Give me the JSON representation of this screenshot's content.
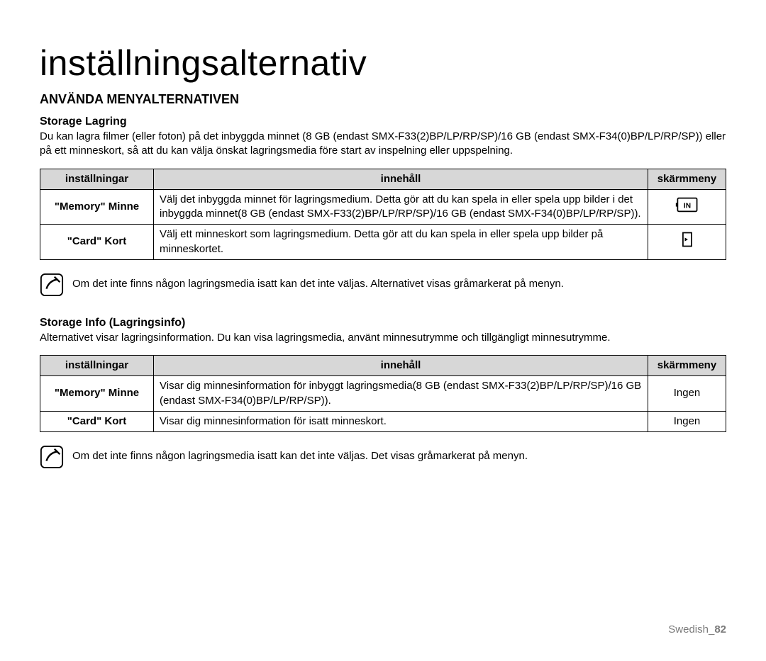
{
  "page_title": "inställningsalternativ",
  "section_title": "ANVÄNDA MENYALTERNATIVEN",
  "storage": {
    "heading": "Storage Lagring",
    "paragraph": "Du kan lagra filmer (eller foton) på det inbyggda minnet (8 GB (endast SMX-F33(2)BP/LP/RP/SP)/16 GB (endast SMX-F34(0)BP/LP/RP/SP)) eller på ett minneskort, så att du kan välja önskat lagringsmedia före start av inspelning eller uppspelning.",
    "table": {
      "headers": {
        "settings": "inställningar",
        "content": "innehåll",
        "screen": "skärmmeny"
      },
      "rows": [
        {
          "label": "\"Memory\" Minne",
          "content": "Välj det inbyggda minnet för lagringsmedium. Detta gör att du kan spela in eller spela upp bilder i det inbyggda minnet(8 GB (endast SMX-F33(2)BP/LP/RP/SP)/16 GB (endast SMX-F34(0)BP/LP/RP/SP)).",
          "icon": "internal-memory-icon"
        },
        {
          "label": "\"Card\" Kort",
          "content": "Välj ett minneskort som lagringsmedium. Detta gör att du kan spela in eller spela upp bilder på minneskortet.",
          "icon": "memory-card-icon"
        }
      ]
    },
    "note": "Om det inte finns någon lagringsmedia isatt kan det inte väljas. Alternativet visas gråmarkerat på menyn."
  },
  "storage_info": {
    "heading": "Storage Info (Lagringsinfo)",
    "paragraph": "Alternativet visar lagringsinformation. Du kan visa lagringsmedia, använt minnesutrymme och tillgängligt minnesutrymme.",
    "table": {
      "headers": {
        "settings": "inställningar",
        "content": "innehåll",
        "screen": "skärmmeny"
      },
      "rows": [
        {
          "label": "\"Memory\" Minne",
          "content": "Visar dig minnesinformation för inbyggt lagringsmedia(8 GB (endast SMX-F33(2)BP/LP/RP/SP)/16 GB (endast SMX-F34(0)BP/LP/RP/SP)).",
          "screen": "Ingen"
        },
        {
          "label": "\"Card\" Kort",
          "content": "Visar dig minnesinformation för isatt minneskort.",
          "screen": "Ingen"
        }
      ]
    },
    "note": "Om det inte finns någon lagringsmedia isatt kan det inte väljas. Det visas gråmarkerat på menyn."
  },
  "footer": {
    "language": "Swedish",
    "page_number": "82"
  }
}
